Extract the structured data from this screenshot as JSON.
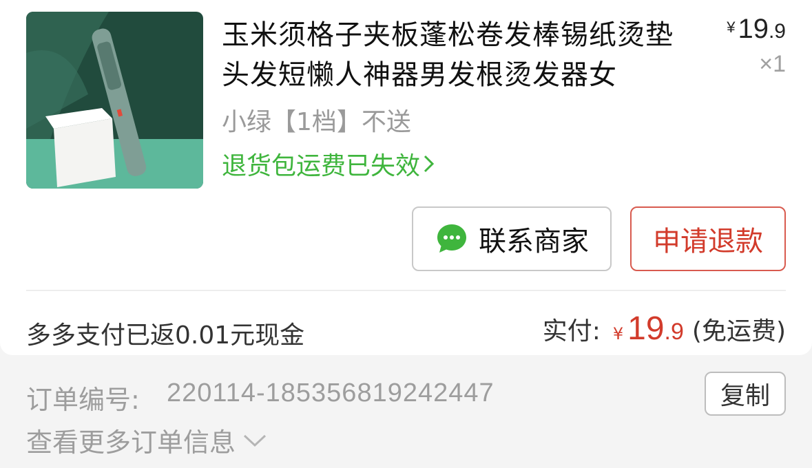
{
  "product": {
    "title": "玉米须格子夹板蓬松卷发棒锡纸烫垫头发短懒人神器男发根烫发器女",
    "sku": "小绿【1档】不送",
    "return_notice": "退货包运费已失效",
    "price_symbol": "¥",
    "price_int": "19",
    "price_dec": ".9",
    "quantity": "×1"
  },
  "actions": {
    "contact_label": "联系商家",
    "refund_label": "申请退款"
  },
  "summary": {
    "cashback_text": "多多支付已返0.01元现金",
    "paid_label": "实付:",
    "paid_symbol": "¥",
    "paid_int": "19",
    "paid_dec": ".9",
    "shipping_note": "(免运费)"
  },
  "order": {
    "number_label": "订单编号:",
    "number": "220114-185356819242447",
    "copy_label": "复制",
    "more_label": "查看更多订单信息"
  },
  "colors": {
    "accent_red": "#d23b2b",
    "link_green": "#3fb53d"
  },
  "icons": {
    "chat": "chat-bubble-icon",
    "chevron_right": "chevron-right-icon",
    "chevron_down": "chevron-down-icon"
  }
}
